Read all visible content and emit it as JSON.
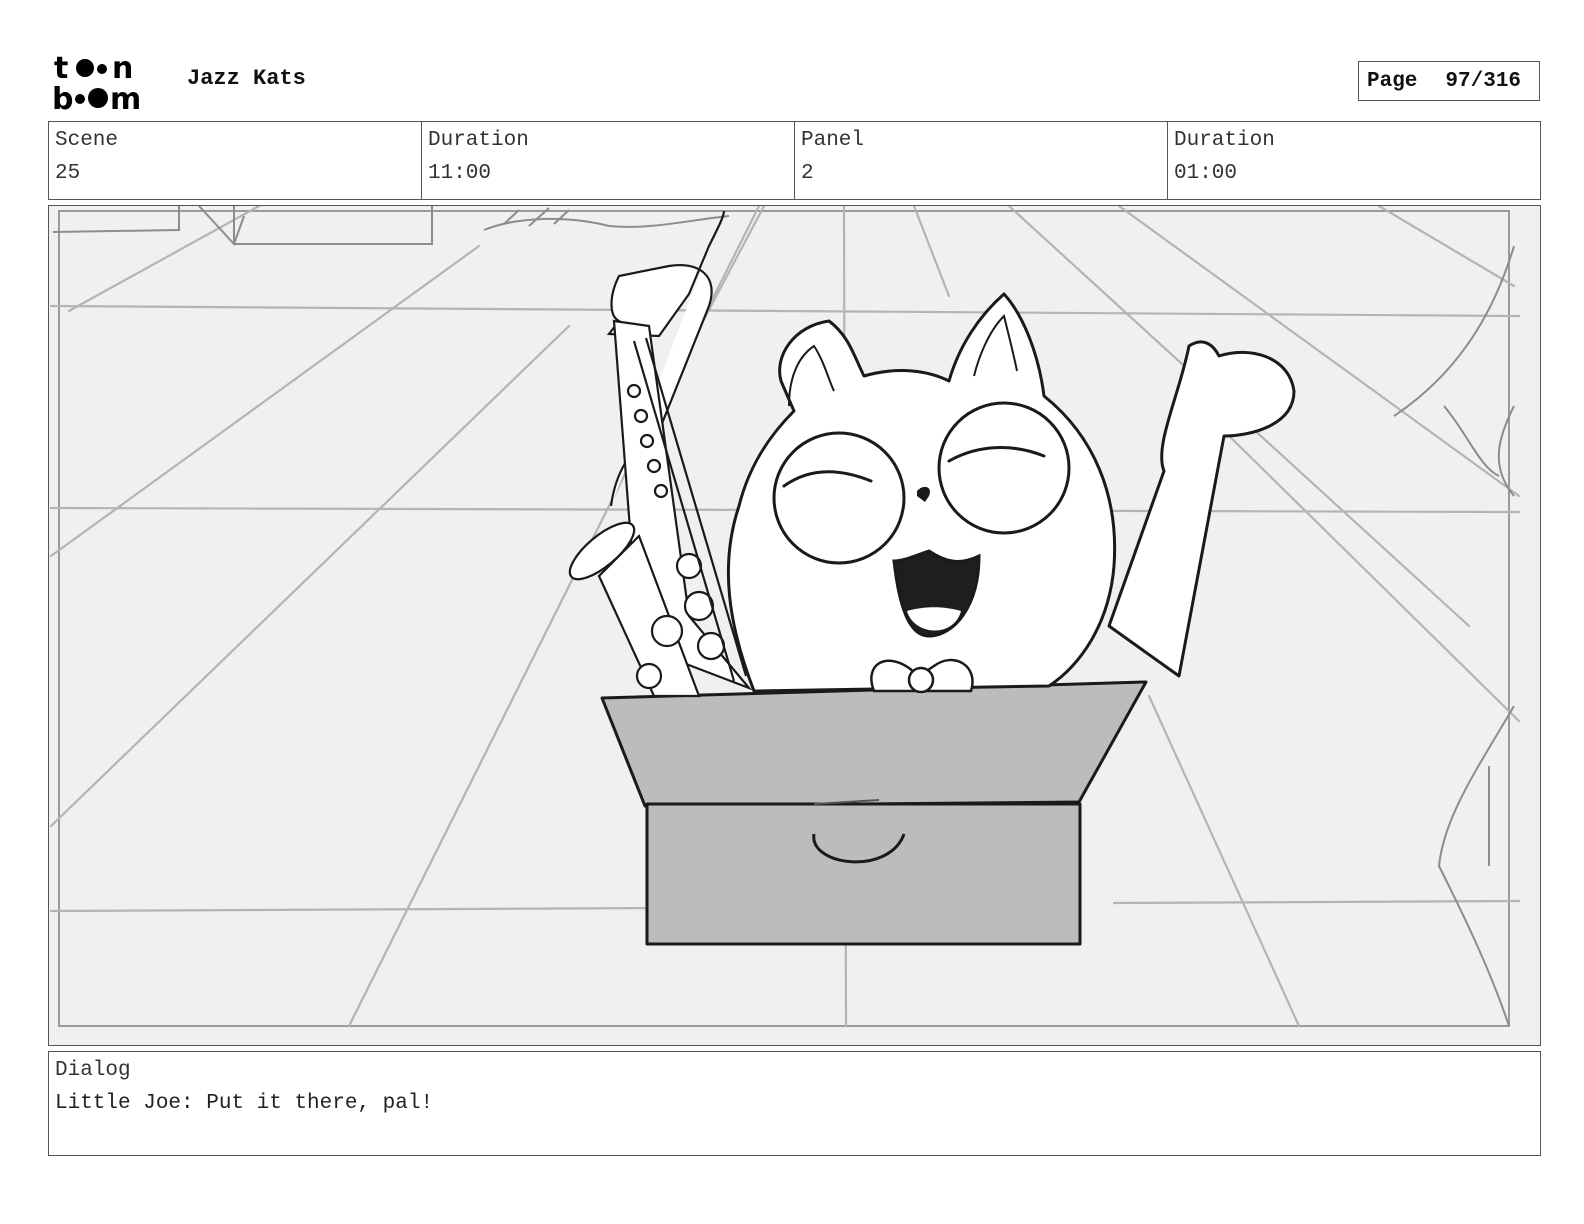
{
  "header": {
    "logo_text": "toon boom",
    "project_title": "Jazz Kats",
    "page_label": "Page",
    "page_number": "97/316"
  },
  "info": {
    "scene_label": "Scene",
    "scene_value": "25",
    "scene_duration_label": "Duration",
    "scene_duration_value": "11:00",
    "panel_label": "Panel",
    "panel_value": "2",
    "panel_duration_label": "Duration",
    "panel_duration_value": "01:00"
  },
  "dialog": {
    "label": "Dialog",
    "text": "Little Joe: Put it there, pal!"
  }
}
